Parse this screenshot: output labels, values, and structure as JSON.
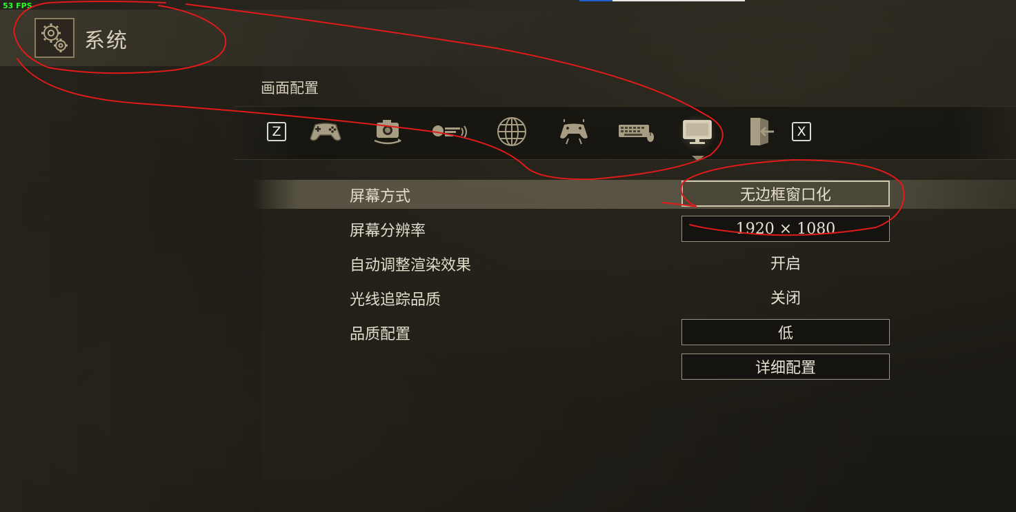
{
  "overlay": {
    "fps_text": "53 FPS"
  },
  "header": {
    "title": "系统",
    "icon": "gear-icon"
  },
  "section": {
    "title": "画面配置"
  },
  "tabs": [
    {
      "key": "Z",
      "icon": "key-z-icon"
    },
    {
      "icon": "gamepad-icon"
    },
    {
      "icon": "camera-icon"
    },
    {
      "icon": "sound-icon"
    },
    {
      "icon": "globe-icon"
    },
    {
      "icon": "controller-settings-icon"
    },
    {
      "icon": "keyboard-mouse-icon"
    },
    {
      "icon": "monitor-icon",
      "active": true
    },
    {
      "icon": "exit-door-icon"
    },
    {
      "key": "X",
      "icon": "key-x-icon"
    }
  ],
  "settings": [
    {
      "label": "屏幕方式",
      "value": "无边框窗口化",
      "style": "box",
      "selected": true
    },
    {
      "label": "屏幕分辨率",
      "value": "1920 × 1080",
      "style": "box"
    },
    {
      "label": "自动调整渲染效果",
      "value": "开启",
      "style": "text"
    },
    {
      "label": "光线追踪品质",
      "value": "关闭",
      "style": "text"
    },
    {
      "label": "品质配置",
      "value": "低",
      "style": "box"
    },
    {
      "label": "",
      "value": "详细配置",
      "style": "box"
    }
  ],
  "colors": {
    "background": "#1a1813",
    "text": "#e2dccb",
    "highlight_row": "#605b4a",
    "annotation": "#e11a1a",
    "fps": "#2aff2a"
  }
}
